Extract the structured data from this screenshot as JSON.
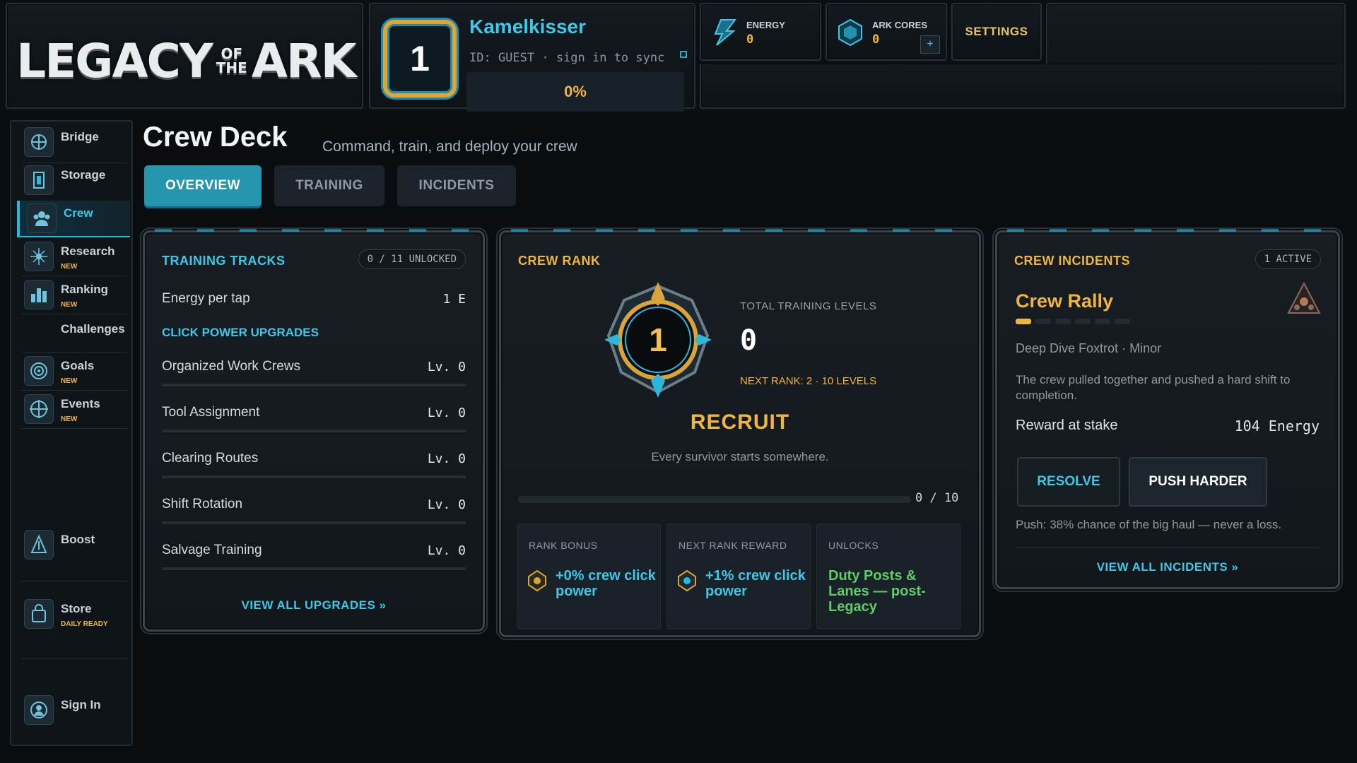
{
  "header": {
    "logo": {
      "word1": "LEGACY",
      "of": "OF",
      "the": "THE",
      "word2": "ARK"
    },
    "player": {
      "level": "1",
      "name": "Kamelkisser",
      "id_text": "ID: GUEST · sign in to sync",
      "progress": "0%"
    },
    "resources": [
      {
        "label": "ENERGY",
        "value": "0",
        "icon": "lightning-icon"
      },
      {
        "label": "ARK CORES",
        "value": "0",
        "icon": "hexagon-core-icon",
        "add": "+"
      }
    ],
    "settings_label": "SETTINGS"
  },
  "sidebar": {
    "items": [
      {
        "label": "Bridge",
        "icon": "bridge-icon",
        "badge": ""
      },
      {
        "label": "Storage",
        "icon": "storage-icon",
        "badge": ""
      },
      {
        "label": "Crew",
        "icon": "crew-icon",
        "badge": "",
        "active": true
      },
      {
        "label": "Research",
        "icon": "research-icon",
        "badge": "NEW"
      },
      {
        "label": "Ranking",
        "icon": "ranking-icon",
        "badge": "NEW"
      },
      {
        "label": "Challenges",
        "icon": "",
        "badge": ""
      },
      {
        "label": "Goals",
        "icon": "goals-icon",
        "badge": "NEW"
      },
      {
        "label": "Events",
        "icon": "events-icon",
        "badge": "NEW"
      },
      {
        "label": "Boost",
        "icon": "boost-icon",
        "badge": ""
      },
      {
        "label": "Store",
        "icon": "store-icon",
        "badge": "DAILY READY"
      },
      {
        "label": "Sign In",
        "icon": "user-icon",
        "badge": ""
      }
    ]
  },
  "page": {
    "title": "Crew Deck",
    "subtitle": "Command, train, and deploy your crew",
    "tabs": [
      {
        "label": "OVERVIEW",
        "active": true
      },
      {
        "label": "TRAINING",
        "active": false
      },
      {
        "label": "INCIDENTS",
        "active": false
      }
    ]
  },
  "training_tracks": {
    "title": "TRAINING TRACKS",
    "unlocked": "0 / 11 UNLOCKED",
    "energy_row": {
      "label": "Energy per tap",
      "value": "1 E"
    },
    "section_label": "CLICK POWER UPGRADES",
    "upgrades": [
      {
        "name": "Organized Work Crews",
        "level": "Lv. 0"
      },
      {
        "name": "Tool Assignment",
        "level": "Lv. 0"
      },
      {
        "name": "Clearing Routes",
        "level": "Lv. 0"
      },
      {
        "name": "Shift Rotation",
        "level": "Lv. 0"
      },
      {
        "name": "Salvage Training",
        "level": "Lv. 0"
      }
    ],
    "link": "VIEW ALL UPGRADES »"
  },
  "crew_rank": {
    "title": "CREW RANK",
    "rank_number": "1",
    "total_label": "TOTAL TRAINING LEVELS",
    "total_value": "0",
    "next_rank": "NEXT RANK: 2 · 10 LEVELS",
    "rank_name": "RECRUIT",
    "quote": "Every survivor starts somewhere.",
    "progress_text": "0 / 10",
    "progress_fraction": 0,
    "tiles": [
      {
        "label": "RANK BONUS",
        "value": "+0% crew click power"
      },
      {
        "label": "NEXT RANK REWARD",
        "value": "+1% crew click power"
      },
      {
        "label": "UNLOCKS",
        "value": "Duty Posts & Lanes — post-Legacy"
      }
    ]
  },
  "crew_incidents": {
    "title": "CREW INCIDENTS",
    "active": "1 ACTIVE",
    "incident_title": "Crew Rally",
    "meta_location": "Deep Dive Foxtrot",
    "meta_severity": "Minor",
    "description": "The crew pulled together and pushed a hard shift to completion.",
    "reward_label": "Reward at stake",
    "reward_value": "104 Energy",
    "resolve_label": "RESOLVE",
    "push_label": "PUSH HARDER",
    "push_note": "Push: 38% chance of the big haul — never a loss.",
    "link": "VIEW ALL INCIDENTS »",
    "segments_filled": 1,
    "segments_total": 6
  },
  "colors": {
    "accent": "#3ec8e8",
    "gold": "#f0b53c",
    "green": "#5fcc6a",
    "bg": "#0a0d10"
  }
}
